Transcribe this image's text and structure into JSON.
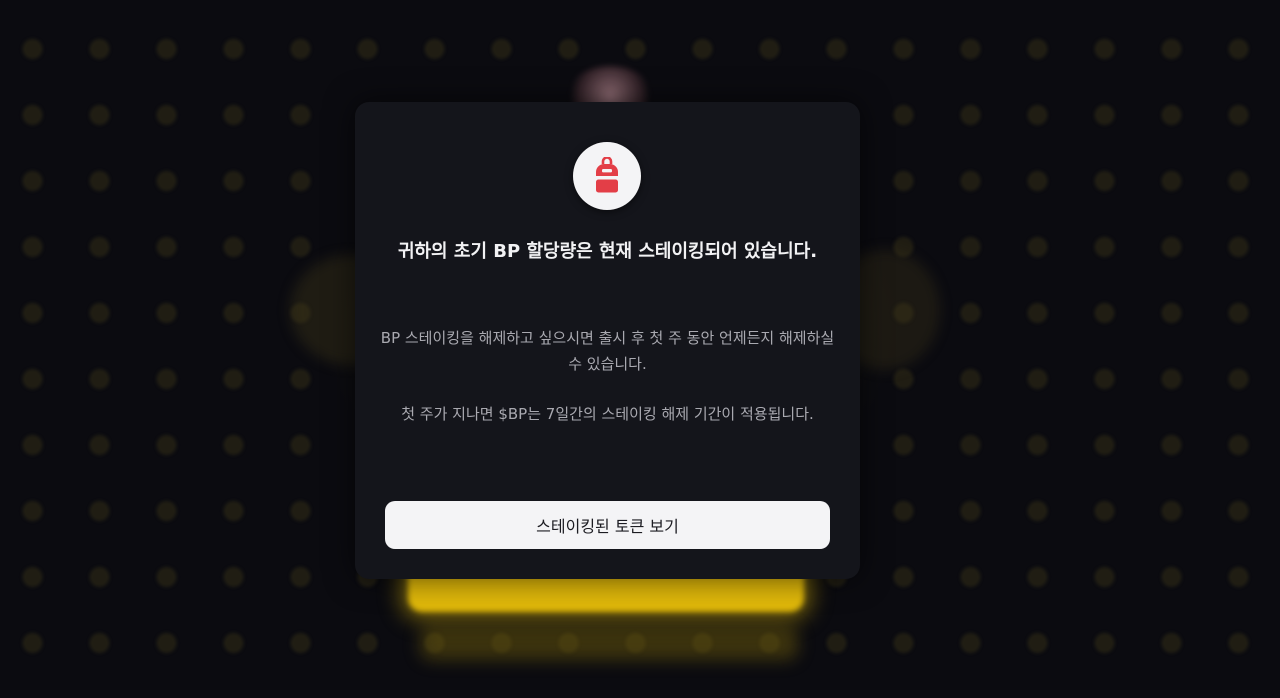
{
  "modal": {
    "icon": "backpack-icon",
    "title": "귀하의 초기 BP 할당량은 현재 스테이킹되어 있습니다.",
    "description_1": "BP 스테이킹을 해제하고 싶으시면 출시 후 첫 주 동안 언제든지 해제하실 수 있습니다.",
    "description_2": "첫 주가 지나면 $BP는 7일간의 스테이킹 해제 기간이 적용됩니다.",
    "button_label": "스테이킹된 토큰 보기"
  },
  "colors": {
    "modal_background": "#14151b",
    "page_background": "#0b0b10",
    "icon_accent": "#e33e47",
    "button_background": "#f4f4f6",
    "glow_gold": "#e0b80a"
  }
}
